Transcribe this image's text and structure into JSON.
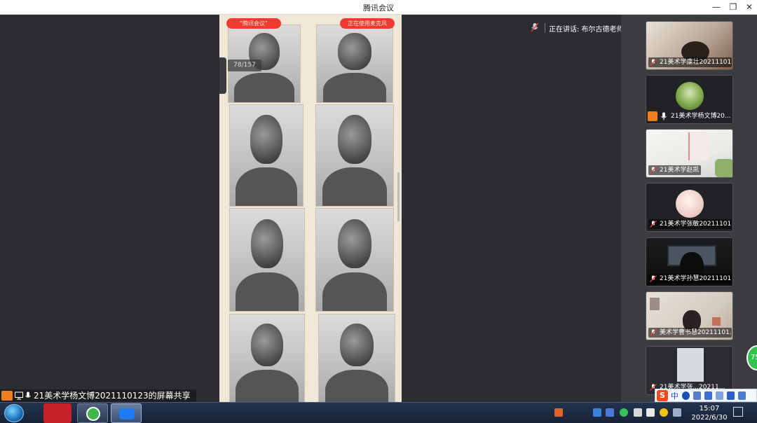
{
  "window": {
    "title": "腾讯会议",
    "minimize_glyph": "—",
    "restore_glyph": "❐",
    "close_glyph": "✕"
  },
  "share": {
    "pill_left": "“腾讯会议”",
    "pill_right": "正在使用麦克风",
    "page_counter": "78/157"
  },
  "speaking": {
    "label": "正在讲话: 布尔古德老师; 美术..."
  },
  "participants": [
    {
      "name": "21美术学康壮20211101...",
      "video": "camera"
    },
    {
      "name": "21美术学杨文博20...",
      "video": "avatar-tree",
      "host": true
    },
    {
      "name": "21美术学赵凯",
      "video": "camera"
    },
    {
      "name": "21美术学张敏20211101...",
      "video": "avatar-pink"
    },
    {
      "name": "21美术学孙慧20211101...",
      "video": "camera"
    },
    {
      "name": "美术学曹书慧20211101...",
      "video": "camera"
    },
    {
      "name": "21美术学张...20211...",
      "video": "camera"
    }
  ],
  "screen_share_bar": {
    "label": "21美术学杨文博2021110123的屏幕共享"
  },
  "floating_badge": {
    "value": "75"
  },
  "ime": {
    "logo": "S",
    "mode": "中"
  },
  "taskbar": {
    "time": "15:07",
    "date": "2022/6/30"
  },
  "icons": {
    "start": "windows-start-icon",
    "app1": "netease-music-icon",
    "app2": "browser-360-icon",
    "app3": "tencent-meeting-icon"
  },
  "colors": {
    "accent_red": "#f03a2f",
    "host_orange": "#f07d1e",
    "badge_green": "#32c24d"
  }
}
